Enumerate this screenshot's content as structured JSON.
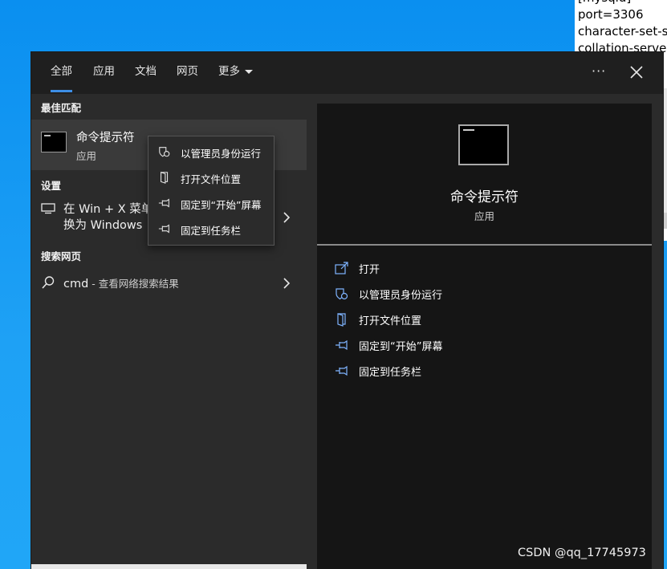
{
  "background_text": {
    "lines": [
      "[mysqld]",
      "port=3306",
      "character-set-s",
      "collation-serve"
    ]
  },
  "topbar": {
    "tabs": [
      {
        "label": "全部",
        "active": true
      },
      {
        "label": "应用"
      },
      {
        "label": "文档"
      },
      {
        "label": "网页"
      },
      {
        "label": "更多"
      }
    ],
    "more_options": "···",
    "close": "✕"
  },
  "left": {
    "best_match_header": "最佳匹配",
    "best_match": {
      "title": "命令提示符",
      "subtitle": "应用",
      "icon": "cmd-icon"
    },
    "settings_header": "设置",
    "settings_item": {
      "line1": "在 Win + X 菜单",
      "line2": "换为 Windows",
      "icon": "monitor-icon"
    },
    "web_header": "搜索网页",
    "web_item": {
      "query": "cmd",
      "suffix": " - 查看网络搜索结果",
      "icon": "search-icon"
    }
  },
  "context_menu": {
    "items": [
      {
        "label": "以管理员身份运行",
        "icon": "shield-icon"
      },
      {
        "label": "打开文件位置",
        "icon": "file-icon"
      },
      {
        "label": "固定到“开始”屏幕",
        "icon": "pin-icon"
      },
      {
        "label": "固定到任务栏",
        "icon": "pin-icon"
      }
    ]
  },
  "preview": {
    "title": "命令提示符",
    "subtitle": "应用",
    "actions": [
      {
        "label": "打开",
        "icon": "open-icon"
      },
      {
        "label": "以管理员身份运行",
        "icon": "shield-icon"
      },
      {
        "label": "打开文件位置",
        "icon": "file-icon"
      },
      {
        "label": "固定到“开始”屏幕",
        "icon": "pin-icon"
      },
      {
        "label": "固定到任务栏",
        "icon": "pin-icon"
      }
    ]
  },
  "watermark": "CSDN @qq_17745973",
  "colors": {
    "accent": "#3d8ee6",
    "panel_bg": "#2b2b2b",
    "preview_bg": "#151515",
    "highlight": "#3a3a3a",
    "icon_blue": "#7fb4ff"
  }
}
